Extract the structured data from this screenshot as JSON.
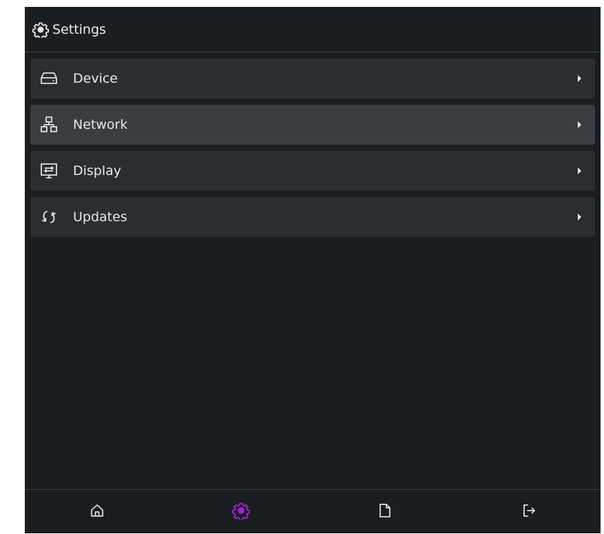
{
  "header": {
    "title": "Settings",
    "icon": "gear-icon"
  },
  "menu": {
    "items": [
      {
        "label": "Device",
        "icon": "hard-drive-icon"
      },
      {
        "label": "Network",
        "icon": "network-icon"
      },
      {
        "label": "Display",
        "icon": "monitor-icon"
      },
      {
        "label": "Updates",
        "icon": "sync-icon"
      }
    ],
    "hovered_item": "Network"
  },
  "bottom_nav": {
    "items": [
      {
        "icon": "home-icon",
        "active": false
      },
      {
        "icon": "gear-icon",
        "active": true
      },
      {
        "icon": "file-icon",
        "active": false
      },
      {
        "icon": "logout-icon",
        "active": false
      }
    ]
  },
  "colors": {
    "background": "#1b1e20",
    "menu_item": "#2b2e31",
    "menu_item_hover": "#3a3d42",
    "text": "#e8e8e8",
    "accent": "#a020d0"
  }
}
